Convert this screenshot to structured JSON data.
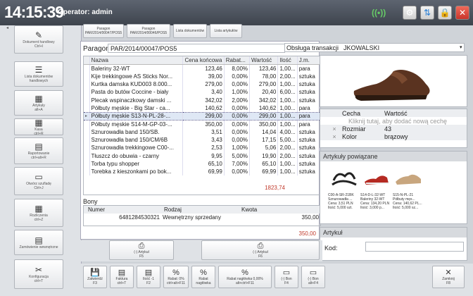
{
  "topbar": {
    "time": "14:15:39",
    "operator": "Operator: admin"
  },
  "sidebar": {
    "collapse": "◂",
    "items": [
      {
        "label": "Dokument handlowy",
        "shortcut": "Ctrl+I",
        "icon": "✎"
      },
      {
        "label": "Lista dokumentów handlowych",
        "shortcut": "",
        "icon": "☰"
      },
      {
        "label": "Artykuły",
        "shortcut": "alt+A",
        "icon": "▦"
      },
      {
        "label": "Kasa",
        "shortcut": "ctrl+R",
        "icon": "▦"
      },
      {
        "label": "Raportowanie",
        "shortcut": "ctrl+alt+R",
        "icon": "▤"
      },
      {
        "label": "Otwórz szufladę",
        "shortcut": "Ctrl+J",
        "icon": "▭"
      },
      {
        "label": "Rozliczenia",
        "shortcut": "ctrl+Z",
        "icon": "▦"
      },
      {
        "label": "Zamówienie wewnętrzne",
        "shortcut": "",
        "icon": "▤"
      },
      {
        "label": "Konfiguracja",
        "shortcut": "ctrl+T",
        "icon": "✂"
      }
    ]
  },
  "tabs": [
    {
      "label": "Paragon",
      "sub": "PAR/2014/00047/POS5"
    },
    {
      "label": "Paragon",
      "sub": "PAR/2014/00046/POS5"
    },
    {
      "label": "Lista dokumentów",
      "sub": ""
    },
    {
      "label": "Lista artykułów",
      "sub": ""
    }
  ],
  "receipt": {
    "label": "Paragon",
    "number": "PAR/2014/00047/POS5",
    "handling_label": "Obsługa transakcji",
    "handler": "JKOWALSKI",
    "total": "1823,74"
  },
  "items": {
    "columns": [
      "Nazwa",
      "Cena końcowa",
      "Rabat...",
      "Wartość",
      "Ilość",
      "J.m."
    ],
    "rows": [
      [
        "Baleriny 32-WT",
        "123,46",
        "8,00%",
        "123,46",
        "1,00...",
        "para"
      ],
      [
        "Kije trekkingowe AS Sticks Nor...",
        "39,00",
        "0,00%",
        "78,00",
        "2,00...",
        "sztuka"
      ],
      [
        "Kurtka damska KUD003 8.000...",
        "279,00",
        "0,00%",
        "279,00",
        "1,00...",
        "sztuka"
      ],
      [
        "Pasta do butów Coccine - biały",
        "3,40",
        "1,00%",
        "20,40",
        "6,00...",
        "sztuka"
      ],
      [
        "Plecak wspinaczkowy damski ...",
        "342,02",
        "2,00%",
        "342,02",
        "1,00...",
        "sztuka"
      ],
      [
        "Półbuty męskie - Big Star - ca...",
        "140,62",
        "0,00%",
        "140,62",
        "1,00...",
        "para"
      ],
      [
        "Półbuty męskie S13-N-PL-28-...",
        "299,00",
        "0,00%",
        "299,00",
        "1,00...",
        "para"
      ],
      [
        "Półbuty męskie S14-M-GP-03-...",
        "350,00",
        "0,00%",
        "350,00",
        "1,00...",
        "para"
      ],
      [
        "Sznurowadła band 150/SB.",
        "3,51",
        "0,00%",
        "14,04",
        "4,00...",
        "sztuka"
      ],
      [
        "Sznurowadła band 150/CM/6B",
        "3,43",
        "0,00%",
        "17,15",
        "5,00...",
        "sztuka"
      ],
      [
        "Sznurowadła trekkingowe C00-...",
        "2,53",
        "1,00%",
        "5,06",
        "2,00...",
        "sztuka"
      ],
      [
        "Tłuszcz do obuwia - czarny",
        "9,95",
        "5,00%",
        "19,90",
        "2,00...",
        "sztuka"
      ],
      [
        "Torba typu shopper",
        "65,10",
        "7,00%",
        "65,10",
        "1,00...",
        "sztuka"
      ],
      [
        "Torebka z kieszonkami po bok...",
        "69,99",
        "0,00%",
        "69,99",
        "1,00...",
        "sztuka"
      ]
    ]
  },
  "vouchers": {
    "title": "Bony",
    "columns": [
      "Numer",
      "Rodzaj",
      "Kwota"
    ],
    "rows": [
      [
        "6481284530321",
        "Wewnętrzny sprzedany",
        "350,00"
      ]
    ],
    "total": "350,00"
  },
  "mid_buttons": [
    {
      "label": "(-) Artykuł",
      "shortcut": "F5"
    },
    {
      "label": "(-) Artykuł",
      "shortcut": "F6"
    }
  ],
  "attributes": {
    "columns": [
      "Cecha",
      "Wartość"
    ],
    "placeholder": "Kliknij tutaj, aby dodać nową cechę",
    "rows": [
      [
        "Rozmiar",
        "43"
      ],
      [
        "Kolor",
        "brązowy"
      ]
    ]
  },
  "related": {
    "title": "Artykuły powiązane",
    "cards": [
      {
        "name": "C00-A-SR-21BK",
        "desc": "Sznurowadła ...",
        "price": "Cena: 3,51 PLN",
        "qty": "Ilość: 5,000 szt."
      },
      {
        "name": "S14-D-L-32-WT",
        "desc": "Baleriny 32-WT",
        "price": "Cena: 134,20 PLN",
        "qty": "Ilość: 3,000 p..."
      },
      {
        "name": "S15-N-PL-21",
        "desc": "Półbuty męs...",
        "price": "Cena: 140,62 PL...",
        "qty": "Ilość: 5,000 sz..."
      }
    ]
  },
  "article": {
    "title": "Artykuł",
    "code_label": "Kod:",
    "code_value": ""
  },
  "bottom_buttons": [
    {
      "label": "Zatwierdź",
      "shortcut": "F3",
      "icon": "💾"
    },
    {
      "label": "Faktura",
      "shortcut": "ctrl+T",
      "icon": "▤"
    },
    {
      "label": "Ilość -1",
      "shortcut": "F2",
      "icon": "▤"
    },
    {
      "label": "Rabat: 0%",
      "shortcut": "ctrl+alt+F11",
      "icon": "%"
    },
    {
      "label": "Rabat nagłówka",
      "shortcut": "",
      "icon": "%"
    },
    {
      "label": "Rabat nagłówka 0,00%",
      "shortcut": "alt+ctrl+F11",
      "icon": "%"
    },
    {
      "label": "(-) Bon",
      "shortcut": "F4",
      "icon": "▭"
    },
    {
      "label": "(-) Bon",
      "shortcut": "alt+F4",
      "icon": "▭"
    },
    {
      "label": "Zamknij",
      "shortcut": "F8",
      "icon": "✕"
    }
  ],
  "colors": {
    "topbar": "#4a5059",
    "accent": "#d8463a",
    "total": "#c0392b"
  }
}
